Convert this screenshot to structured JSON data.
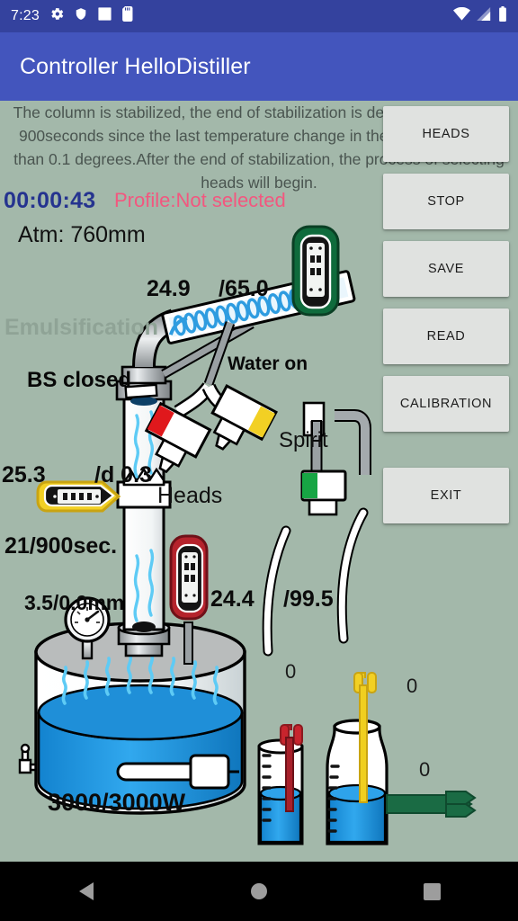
{
  "status_bar": {
    "clock": "7:23",
    "left_icons": [
      "gear-icon",
      "shield-icon",
      "square-icon",
      "sd-card-icon"
    ],
    "right_icons": [
      "wifi-icon",
      "cell-signal-icon",
      "battery-icon"
    ],
    "bg_color": "#34429e"
  },
  "app_bar": {
    "title": "Controller HelloDistiller",
    "bg_color": "#4355bd"
  },
  "main": {
    "bg_color": "#a3b8aa",
    "status_message": "The column is stabilized, the end of stabilization is determined by time: 900seconds since the last temperature change in the column is more than 0.1 degrees.After the end of stabilization, the process of selecting heads will begin.",
    "timer": "00:00:43",
    "timer_color": "#25338f",
    "profile": "Profile:Not selected",
    "profile_color": "#f2577f",
    "readings": {
      "atm": "Atm: 760mm",
      "top_temp": "24.9",
      "top_temp_setpoint": "/65.0",
      "emulsification": "Emulsification",
      "emulsification_color": "#8fa396",
      "bs_state": "BS closed",
      "water_state": "Water on",
      "column_temp": "25.3",
      "column_delta": "/d 0.3",
      "spirit_label": "Spirit",
      "heads_label": "Heads",
      "stabilization": "21/900sec.",
      "pressure": "3.5/0.0mm",
      "cube_temp": "24.4",
      "cube_temp_setpoint": "/99.5",
      "power": "3000/3000W",
      "counter_1": "0",
      "counter_2": "0",
      "counter_3": "0"
    }
  },
  "buttons": [
    {
      "label": "HEADS",
      "name": "heads-button"
    },
    {
      "label": "STOP",
      "name": "stop-button"
    },
    {
      "label": "SAVE",
      "name": "save-button"
    },
    {
      "label": "READ",
      "name": "read-button"
    },
    {
      "label": "CALIBRATION",
      "name": "calibration-button"
    },
    {
      "label": "EXIT",
      "name": "exit-button"
    }
  ],
  "nav_bar": {
    "bg_color": "#000000",
    "buttons": [
      "back-triangle-icon",
      "home-circle-icon",
      "recents-square-icon"
    ]
  }
}
